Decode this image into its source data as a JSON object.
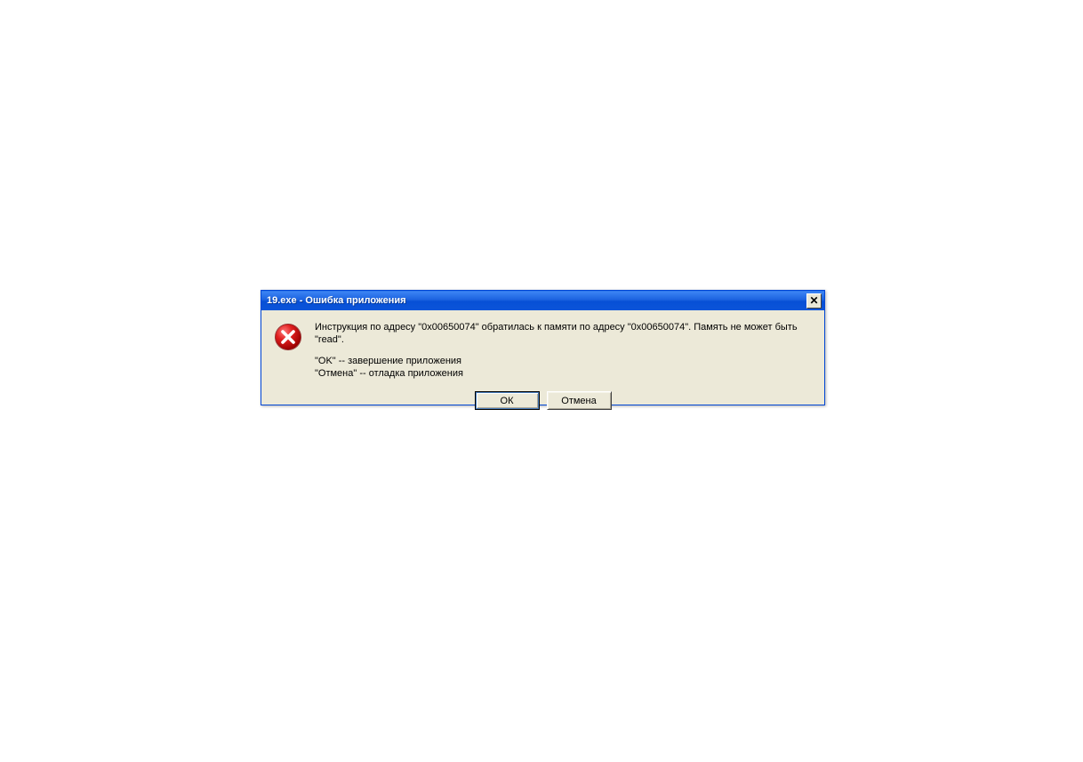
{
  "dialog": {
    "title": "19.exe - Ошибка приложения",
    "icon": "error-icon",
    "message": {
      "line1": "Инструкция по адресу \"0x00650074\" обратилась к памяти по адресу \"0x00650074\". Память не может быть \"read\".",
      "line2": "\"OK\" -- завершение приложения",
      "line3": "\"Отмена\" -- отладка приложения"
    },
    "buttons": {
      "ok_label": "ОК",
      "cancel_label": "Отмена"
    },
    "close_label": "×"
  }
}
